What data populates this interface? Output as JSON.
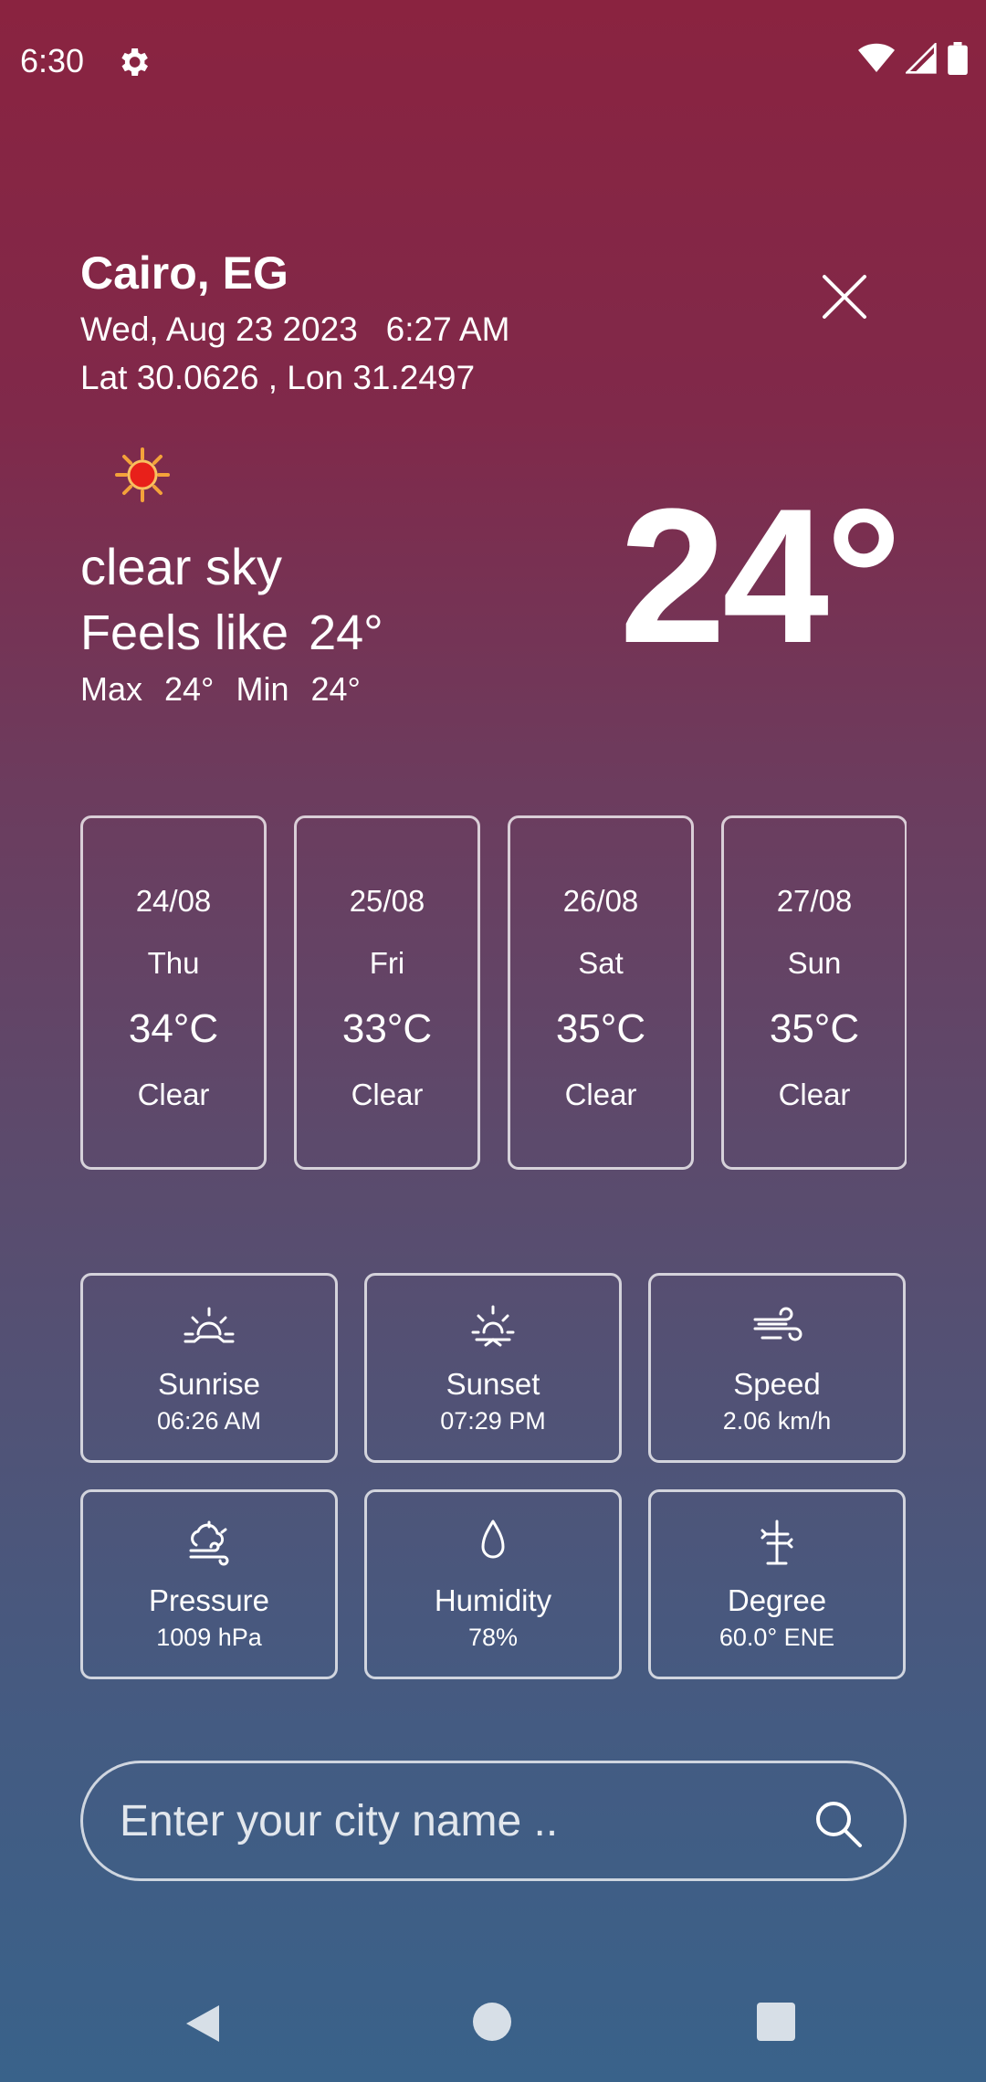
{
  "status_bar": {
    "time": "6:30"
  },
  "header": {
    "city": "Cairo, EG",
    "date": "Wed, Aug 23 2023",
    "time": "6:27 AM",
    "coords": "Lat 30.0626 , Lon 31.2497"
  },
  "current": {
    "description": "clear sky",
    "feels_label": "Feels like",
    "feels_value": "24°",
    "max_label": "Max",
    "max_value": "24°",
    "min_label": "Min",
    "min_value": "24°",
    "temperature": "24°"
  },
  "forecast": [
    {
      "date": "24/08",
      "day": "Thu",
      "temp": "34°C",
      "condition": "Clear"
    },
    {
      "date": "25/08",
      "day": "Fri",
      "temp": "33°C",
      "condition": "Clear"
    },
    {
      "date": "26/08",
      "day": "Sat",
      "temp": "35°C",
      "condition": "Clear"
    },
    {
      "date": "27/08",
      "day": "Sun",
      "temp": "35°C",
      "condition": "Clear"
    }
  ],
  "details": [
    {
      "icon": "sunrise-icon",
      "label": "Sunrise",
      "value": "06:26 AM"
    },
    {
      "icon": "sunset-icon",
      "label": "Sunset",
      "value": "07:29 PM"
    },
    {
      "icon": "wind-icon",
      "label": "Speed",
      "value": "2.06 km/h"
    },
    {
      "icon": "pressure-icon",
      "label": "Pressure",
      "value": "1009 hPa"
    },
    {
      "icon": "humidity-icon",
      "label": "Humidity",
      "value": "78%"
    },
    {
      "icon": "wind-direction-icon",
      "label": "Degree",
      "value": "60.0° ENE"
    }
  ],
  "search": {
    "placeholder": "Enter your city name .."
  },
  "colors": {
    "gradient_top": "#8a2340",
    "gradient_bottom": "#39628a",
    "sun": "#e8201a"
  }
}
